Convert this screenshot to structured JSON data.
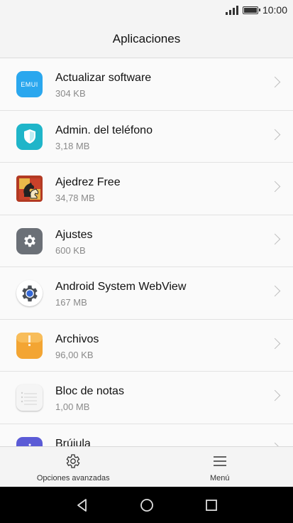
{
  "status_bar": {
    "time": "10:00"
  },
  "header": {
    "title": "Aplicaciones"
  },
  "apps": [
    {
      "name": "Actualizar software",
      "size": "304 KB",
      "icon": "emui-icon",
      "color": "#2aa7ee",
      "icon_text": "EMUI"
    },
    {
      "name": "Admin. del teléfono",
      "size": "3,18 MB",
      "icon": "shield-icon",
      "color": "#1fb5c9"
    },
    {
      "name": "Ajedrez Free",
      "size": "34,78 MB",
      "icon": "chess-icon",
      "color": "#c0392b"
    },
    {
      "name": "Ajustes",
      "size": "600 KB",
      "icon": "gear-icon",
      "color": "#6b7077"
    },
    {
      "name": "Android System WebView",
      "size": "167 MB",
      "icon": "webview-gear-icon",
      "color": "#3367d6"
    },
    {
      "name": "Archivos",
      "size": "96,00 KB",
      "icon": "folder-icon",
      "color": "#f3a533"
    },
    {
      "name": "Bloc de notas",
      "size": "1,00 MB",
      "icon": "notepad-icon",
      "color": "#eeeeee"
    },
    {
      "name": "Brújula",
      "size": "",
      "icon": "compass-icon",
      "color": "#5b5bd6"
    }
  ],
  "bottom_tabs": {
    "advanced_label": "Opciones avanzadas",
    "menu_label": "Menú"
  }
}
